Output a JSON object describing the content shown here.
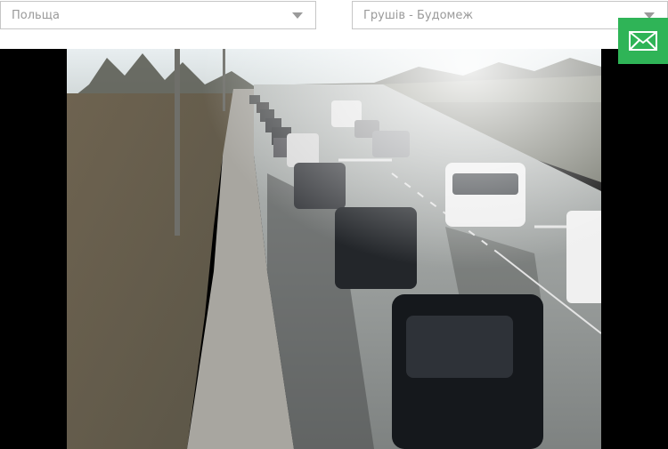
{
  "filters": {
    "country": "Польща",
    "crossing": "Грушів - Будомеж"
  },
  "icons": {
    "country_caret": "chevron-down-icon",
    "crossing_caret": "chevron-down-icon",
    "contact": "envelope-icon"
  },
  "colors": {
    "contact_button": "#2fb457",
    "select_border": "#c6c6c6",
    "select_text": "#9a9a9a",
    "video_background": "#000000"
  }
}
